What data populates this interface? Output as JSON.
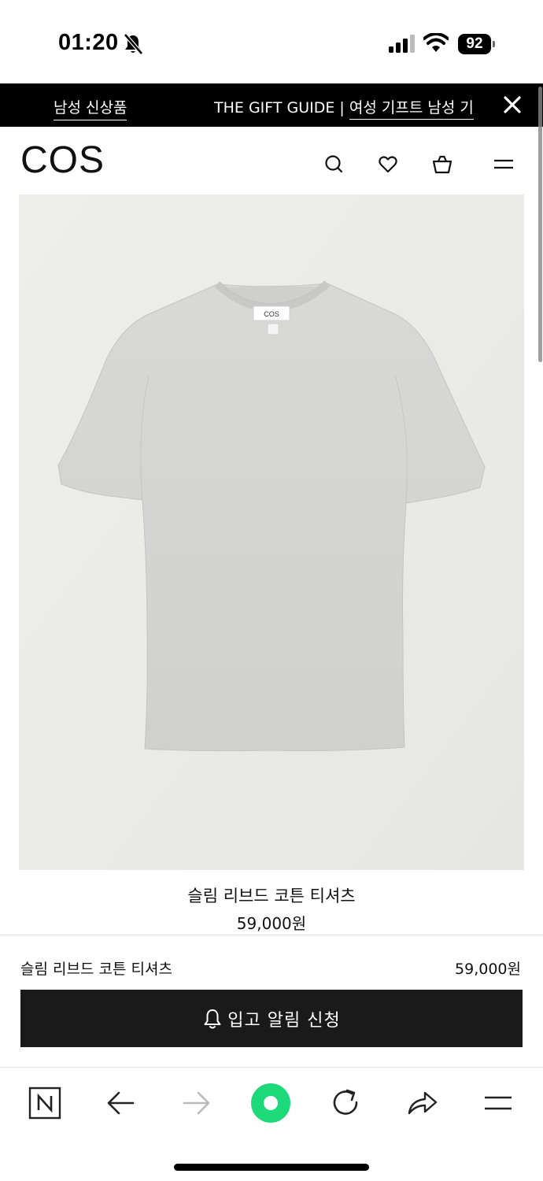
{
  "status_bar": {
    "time": "01:20",
    "battery": "92"
  },
  "promo": {
    "left_link": "남성 신상품",
    "right_text": "THE GIFT GUIDE | ",
    "right_link": "여성 기프트 남성 기"
  },
  "header": {
    "logo": "COS"
  },
  "product": {
    "name": "슬림 리브드 코튼 티셔츠",
    "price": "59,000원",
    "image_alt": "grey t-shirt",
    "tag_text": "COS"
  },
  "sticky_bar": {
    "name": "슬림 리브드 코튼 티셔츠",
    "price": "59,000원",
    "button_label": "입고 알림 신청"
  },
  "colors": {
    "accent": "#1a1a1a",
    "banner": "#000000",
    "image_bg": "#ebebe8",
    "shirt": "#d4d4d2",
    "browser_green": "#1ed97a"
  }
}
